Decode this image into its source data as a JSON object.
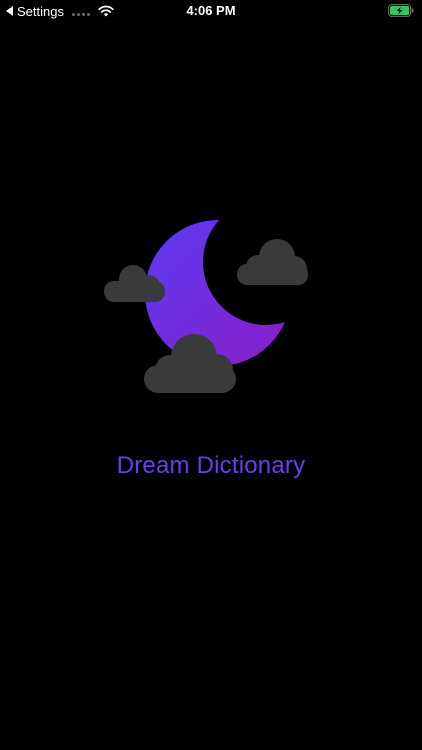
{
  "status_bar": {
    "back_label": "Settings",
    "time": "4:06 PM",
    "battery_color": "#33c759"
  },
  "splash": {
    "app_name": "Dream Dictionary",
    "title_color": "#6b3cf0",
    "moon_gradient": [
      "#5b3cf2",
      "#8a1cc9"
    ],
    "cloud_color": "#3a3a3c"
  }
}
